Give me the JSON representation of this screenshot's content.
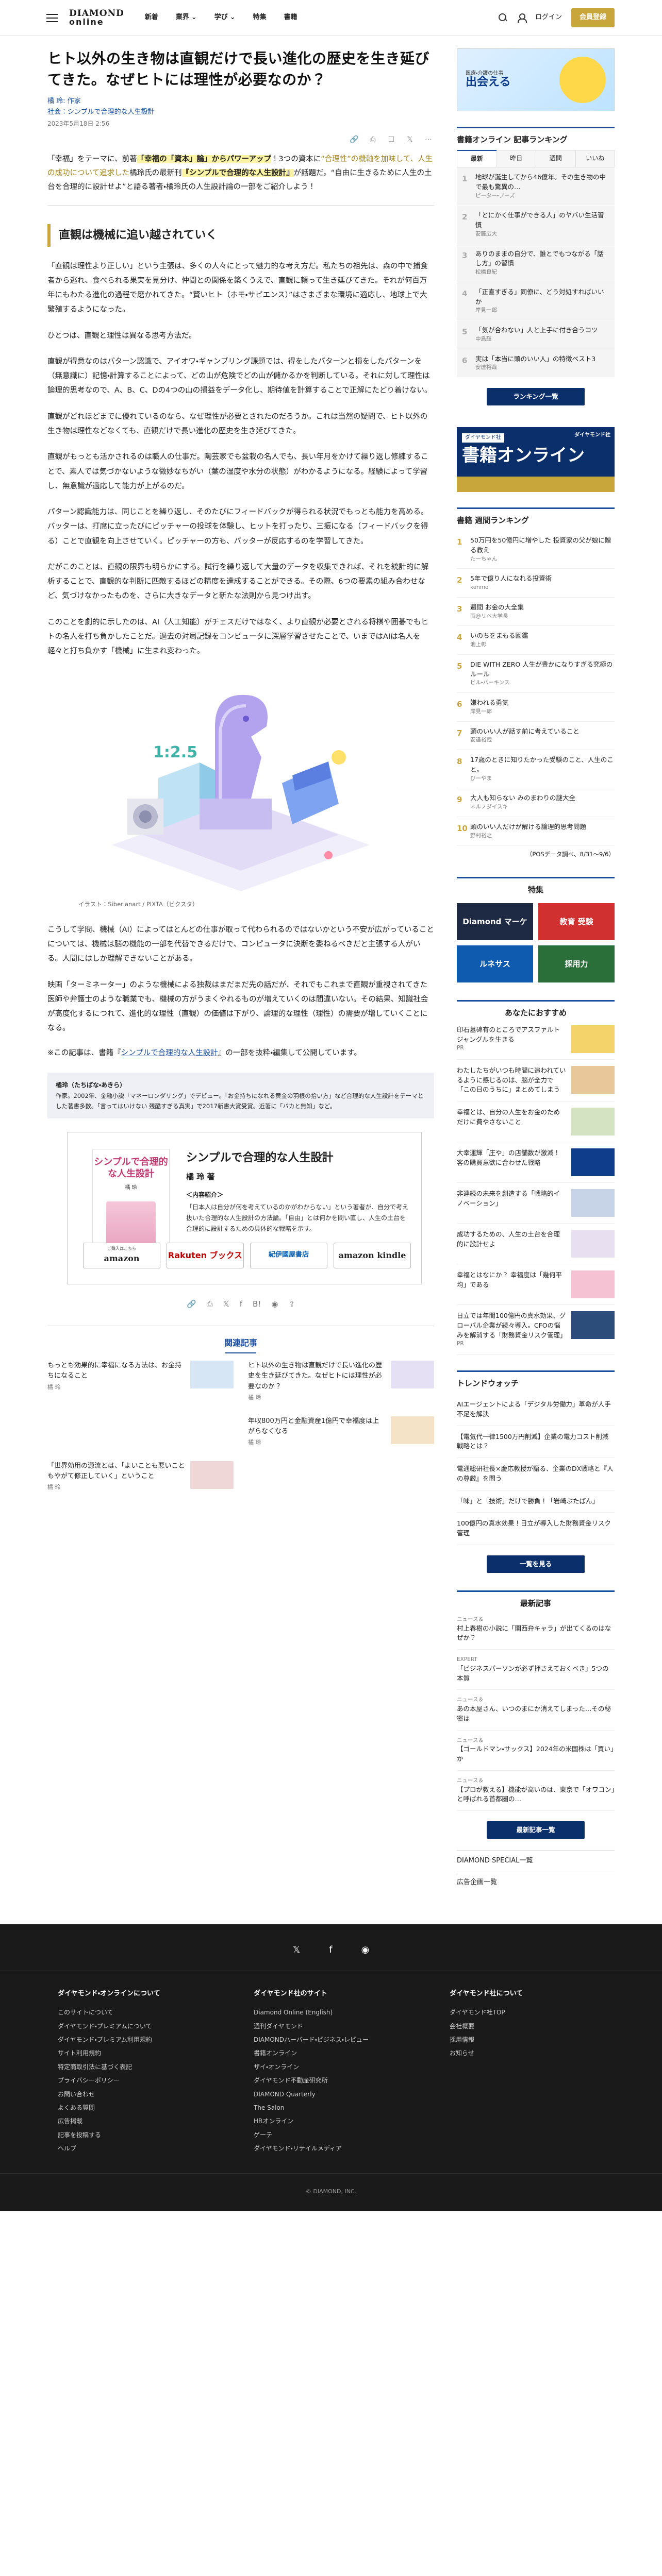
{
  "header": {
    "logo_top": "DIAMOND",
    "logo_bottom": "online",
    "nav": [
      "新着",
      "業界",
      "学び",
      "特集",
      "書籍"
    ],
    "login": "ログイン",
    "register": "会員登録"
  },
  "article": {
    "title": "ヒト以外の生き物は直観だけで長い進化の歴史を生き延びてきた。なぜヒトには理性が必要なのか？",
    "author": "橘 玲: 作家",
    "book_ref": "社会：シンプルで合理的な人生設計",
    "date": "2023年5月18日 2:56",
    "share_icons": [
      "link-icon",
      "print-icon",
      "bookmark-icon",
      "x-icon",
      "more-icon"
    ],
    "lead": [
      {
        "t": "「幸福」をテーマに、前著"
      },
      {
        "t": "「幸福の「資本」論」からパワーアップ",
        "hl": true
      },
      {
        "t": "！3つの資本に"
      },
      {
        "t": "“合理性”の",
        "gold": true
      },
      {
        "t": "機軸を加味して、人生の成功について追求した",
        "gold": true
      },
      {
        "t": "橘玲氏の最新刊"
      },
      {
        "t": "『シンプルで合理的な人生設計』",
        "hl": true
      },
      {
        "t": "が話題だ。“自由に生きるために人生の土台を合理的に設計せよ”と語る著者・橘玲氏の人生設計論の一部をご紹介しよう！"
      }
    ],
    "h2": "直観は機械に追い越されていく",
    "paras": [
      "「直観は理性より正しい」という主張は、多くの人々にとって魅力的な考え方だ。私たちの祖先は、森の中で捕食者から逃れ、食べられる果実を見分け、仲間との関係を築くうえで、直観に頼って生き延びてきた。それが何百万年にもわたる進化の過程で磨かれてきた。“賢いヒト（ホモ・サピエンス）”はさまざまな環境に適応し、地球上で大繁殖するようになった。",
      "ひとつは、直観と理性は異なる思考方法だ。",
      "直観が得意なのはパターン認識で、アイオワ・ギャンブリング課題では、得をしたパターンと損をしたパターンを（無意識に）記憶・計算することによって、どの山が危険でどの山が儲かるかを判断している。それに対して理性は論理的思考なので、A、B、C、Dの4つの山の損益をデータ化し、期待値を計算することで正解にたどり着けない。",
      "直観がどれほどまでに優れているのなら、なぜ理性が必要とされたのだろうか。これは当然の疑問で、ヒト以外の生き物は理性などなくても、直観だけで長い進化の歴史を生き延びてきた。",
      "直観がもっとも活かされるのは職人の仕事だ。陶芸家でも盆栽の名人でも、長い年月をかけて繰り返し修練することで、素人では気づかないような微妙なちがい（葉の湿度や水分の状態）がわかるようになる。経験によって学習し、無意識が適応して能力が上がるのだ。",
      "パターン認識能力は、同じことを繰り返し、そのたびにフィードバックが得られる状況でもっとも能力を高める。バッターは、打席に立ったびにピッチャーの投球を体験し、ヒットを打ったり、三振になる（フィードバックを得る）ことで直観を向上させていく。ピッチャーの方も、バッターが反応するのを学習してきた。",
      "だがこのことは、直観の限界も明らかにする。試行を繰り返して大量のデータを収集できれば、それを統計的に解析することで、直観的な判断に匹敵するほどの精度を達成することができる。その際、6つの要素の組み合わせなど、気づけなかったものを、さらに大きなデータと新たな法則から見つけ出す。",
      "このことを劇的に示したのは、AI（人工知能）がチェスだけではなく、より直観が必要とされる将棋や囲碁でもヒトの名人を打ち負かしたことだ。過去の対局記録をコンピュータに深層学習させたことで、いまではAIは名人を軽々と打ち負かす「機械」に生まれ変わった。"
    ],
    "image_caption": "イラスト：Siberianart / PIXTA（ピクスタ）",
    "image_text": "1:2.5",
    "paras2": [
      "こうして学問、機械（AI）によってはとんどの仕事が取って代わられるのではないかという不安が広がっていることについては、機械は脳の機能の一部を代替できるだけで、コンピュータに決断を委ねるべきだと主張する人がいる。人間にはしか理解できないことがある。",
      "映画「ターミネーター」のような機械による独裁はまだまだ先の話だが、それでもこれまで直観が重視されてきた医師や弁護士のような職業でも、機械の方がうまくやれるものが増えていくのは間違いない。その結果、知識社会が高度化するにつれて、進化的な理性（直観）の価値は下がり、論理的な理性（理性）の需要が増していくことになる。"
    ],
    "note_prefix": "※この記事は、書籍『",
    "note_link": "シンプルで合理的な人生設計",
    "note_suffix": "』の一部を抜粋・編集して公開しています。",
    "profile_head": "橘玲（たちばな・あきら）",
    "profile_text": "作家。2002年、金融小説「マネーロンダリング」でデビュー。「お金持ちになれる黄金の羽根の拾い方」など合理的な人生設計をテーマとした著書多数。「言ってはいけない 残酷すぎる真実」で2017新書大賞受賞。近著に「バカと無知」など。",
    "book": {
      "cover_title": "シンプルで合理的な人生設計",
      "cover_author": "橘 玲",
      "title": "シンプルで合理的な人生設計",
      "author": "橘 玲 著",
      "desc_head": "＜内容紹介＞",
      "desc": "「日本人は自分が何を考えているのかがわからない」という著者が、自分で考え抜いた合理的な人生設計の方法論。「自由」とは何かを問い直し、人生の土台を合理的に設計するための具体的な戦略を示す。",
      "shops": [
        {
          "name": "amazon",
          "sub": "ご購入はこちら"
        },
        {
          "name": "Rakuten ブックス",
          "sub": ""
        },
        {
          "name": "紀伊國屋書店",
          "sub": ""
        },
        {
          "name": "amazon kindle",
          "sub": ""
        }
      ]
    },
    "share_bottom": [
      "link-icon",
      "print-icon",
      "x-icon",
      "facebook-icon",
      "hatena-icon",
      "line-icon",
      "share-icon"
    ],
    "related_title": "関連記事",
    "related": [
      {
        "title": "もっとも効果的に幸福になる方法は、お金持ちになること",
        "author": "橘 玲",
        "color": "#d7e6f5"
      },
      {
        "title": "ヒト以外の生き物は直観だけで長い進化の歴史を生き延びてきた。なぜヒトには理性が必要なのか？",
        "author": "橘 玲",
        "color": "#e6e0f5"
      },
      {
        "title": "",
        "author": "",
        "color": ""
      },
      {
        "title": "年収800万円と金融資産1億円で幸福度は上がらなくなる",
        "author": "橘 玲",
        "color": "#f5e3c8"
      },
      {
        "title": "「世界効用の源流とは、「よいことも悪いこともやがて修正していく」ということ",
        "author": "橘 玲",
        "color": "#f0d7d7"
      },
      {
        "title": "",
        "author": "",
        "color": ""
      }
    ]
  },
  "sidebar": {
    "ad_top_title": "出会える",
    "ad_top_sub": "医療・介護の仕事",
    "ranking_title": "書籍オンライン 記事ランキング",
    "ranking_tabs": [
      "最新",
      "昨日",
      "週間",
      "いいね"
    ],
    "ranking": [
      {
        "title": "地球が誕生してから46億年。その生き物の中で最も驚異の…",
        "author": "ピーター・ブーズ"
      },
      {
        "title": "「とにかく仕事ができる人」のヤバい生活習慣",
        "author": "安藤広大"
      },
      {
        "title": "ありのままの自分で、誰とでもつながる「話し方」の習慣",
        "author": "松橋良紀"
      },
      {
        "title": "「正直すぎる」同僚に、どう対処すればいいか",
        "author": "岸見一郎"
      },
      {
        "title": "「気が合わない」人と上手に付き合うコツ",
        "author": "中島輝"
      },
      {
        "title": "実は「本当に頭のいい人」の特徴ベスト3",
        "author": "安達裕哉"
      }
    ],
    "ranking_more": "ランキング一覧",
    "ad_book_tag": "ダイヤモンド社",
    "ad_book_big": "書籍オンライン",
    "ad_book_brand": "ダイヤモンド社",
    "weekly_title": "書籍 週間ランキング",
    "weekly": [
      {
        "title": "50万円を50億円に増やした 投資家の父が娘に贈る教え",
        "author": "たーちゃん"
      },
      {
        "title": "5年で億り人になれる投資術",
        "author": "kenmo"
      },
      {
        "title": "週間 お金の大全集",
        "author": "両@リベ大学長"
      },
      {
        "title": "いのちをまもる図鑑",
        "author": "池上彰"
      },
      {
        "title": "DIE WITH ZERO 人生が豊かになりすぎる究極のルール",
        "author": "ビル・パーキンス"
      },
      {
        "title": "嫌われる勇気",
        "author": "岸見一郎"
      },
      {
        "title": "頭のいい人が話す前に考えていること",
        "author": "安達裕哉"
      },
      {
        "title": "17歳のときに知りたかった受験のこと、人生のこと。",
        "author": "びーやま"
      },
      {
        "title": "大人も知らない みのまわりの謎大全",
        "author": "ネルノダイスキ"
      },
      {
        "title": "頭のいい人だけが解ける論理的思考問題",
        "author": "野村裕之"
      }
    ],
    "weekly_pos": "（POSデータ調べ、8/31〜9/6）",
    "feature_title": "特集",
    "features": [
      {
        "label": "Diamond マーケ",
        "color": "#1e2a44"
      },
      {
        "label": "教育 受験",
        "color": "#d0302f"
      },
      {
        "label": "ルネサス",
        "color": "#0f5bb0"
      },
      {
        "label": "採用力",
        "color": "#2a6e3a"
      }
    ],
    "rec_title": "あなたにおすすめ",
    "rec": [
      {
        "title": "印石墓碑有のところでアスファルトジャングルを生きる",
        "author": "PR",
        "color": "#f5d36b"
      },
      {
        "title": "わたしたちがいつも時間に追われているように感じるのは、脳が全力で「この日のうちに」まとめてしまう",
        "author": "",
        "color": "#e8c89a"
      },
      {
        "title": "幸福とは、自分の人生をお金のためだけに費やさないこと",
        "author": "",
        "color": "#d4e4c2"
      },
      {
        "title": "大幸運輝「庄や」の店舗数が激減！客の購買意欲に合わせた戦略",
        "author": "",
        "color": "#0f3d8c"
      },
      {
        "title": "非連続の未来を創造する「戦略的イノベーション」",
        "author": "",
        "color": "#c7d3e6"
      },
      {
        "title": "成功するための、人生の土台を合理的に設計せよ",
        "author": "",
        "color": "#e8e0f0"
      },
      {
        "title": "幸福とはなにか？ 幸福度は「幾何平均」である",
        "author": "",
        "color": "#f5c2d4"
      },
      {
        "title": "日立では年間100億円の真水効果、グローバル企業が続々導入。CFOの悩みを解消する「財務資金リスク管理」",
        "author": "PR",
        "color": "#2c4d7a"
      }
    ],
    "trend_title": "トレンドウォッチ",
    "trend": [
      "AIエージェントによる「デジタル労働力」革命が人手不足を解決",
      "【電気代一律1500万円削減】企業の電力コスト削減戦略とは？",
      "電通総研社長×慶応教授が語る、企業のDX戦略と『人の尊厳』を問う",
      "「味」と「技術」だけで勝負！「岩崎ぶたぱん」",
      "100億円の真水効果！日立が導入した財務資金リスク管理"
    ],
    "trend_more": "一覧を見る",
    "latest_title": "最新記事",
    "latest": [
      {
        "cat": "ニュース＆",
        "title": "村上春樹の小説に「関西弁キャラ」が出てくるのはなぜか？"
      },
      {
        "cat": "EXPERT",
        "title": "「ビジネスパーソンが必ず押さえておくべき」5つの本質"
      },
      {
        "cat": "ニュース＆",
        "title": "あの本屋さん、いつのまにか消えてしまった…その秘密は"
      },
      {
        "cat": "ニュース＆",
        "title": "【ゴールドマン・サックス】2024年の米国株は「買い」か"
      },
      {
        "cat": "ニュース＆",
        "title": "【プロが教える】機能が高いのは、東京で「オワコン」と呼ばれる首都圏の…"
      }
    ],
    "latest_more": "最新記事一覧",
    "links": [
      "DIAMOND SPECIAL一覧",
      "広告企画一覧"
    ]
  },
  "footer": {
    "sns": [
      "x-icon",
      "facebook-icon",
      "rss-icon"
    ],
    "col1_title": "ダイヤモンド・オンラインについて",
    "col1": [
      "このサイトについて",
      "ダイヤモンド・プレミアムについて",
      "ダイヤモンド・プレミアム利用規約",
      "サイト利用規約",
      "特定商取引法に基づく表記",
      "プライバシーポリシー",
      "お問い合わせ",
      "よくある質問",
      "広告掲載",
      "記事を投稿する",
      "ヘルプ"
    ],
    "col2_title": "ダイヤモンド社のサイト",
    "col2": [
      "Diamond Online (English)",
      "週刊ダイヤモンド",
      "DIAMONDハーバード・ビジネス・レビュー",
      "書籍オンライン",
      "ザイ・オンライン",
      "ダイヤモンド不動産研究所",
      "DIAMOND Quarterly",
      "The Salon",
      "HRオンライン",
      "ゲーテ",
      "ダイヤモンド・リテイルメディア"
    ],
    "col3_title": "ダイヤモンド社について",
    "col3": [
      "ダイヤモンド社TOP",
      "会社概要",
      "採用情報",
      "お知らせ"
    ],
    "copyright": "© DIAMOND, INC."
  }
}
